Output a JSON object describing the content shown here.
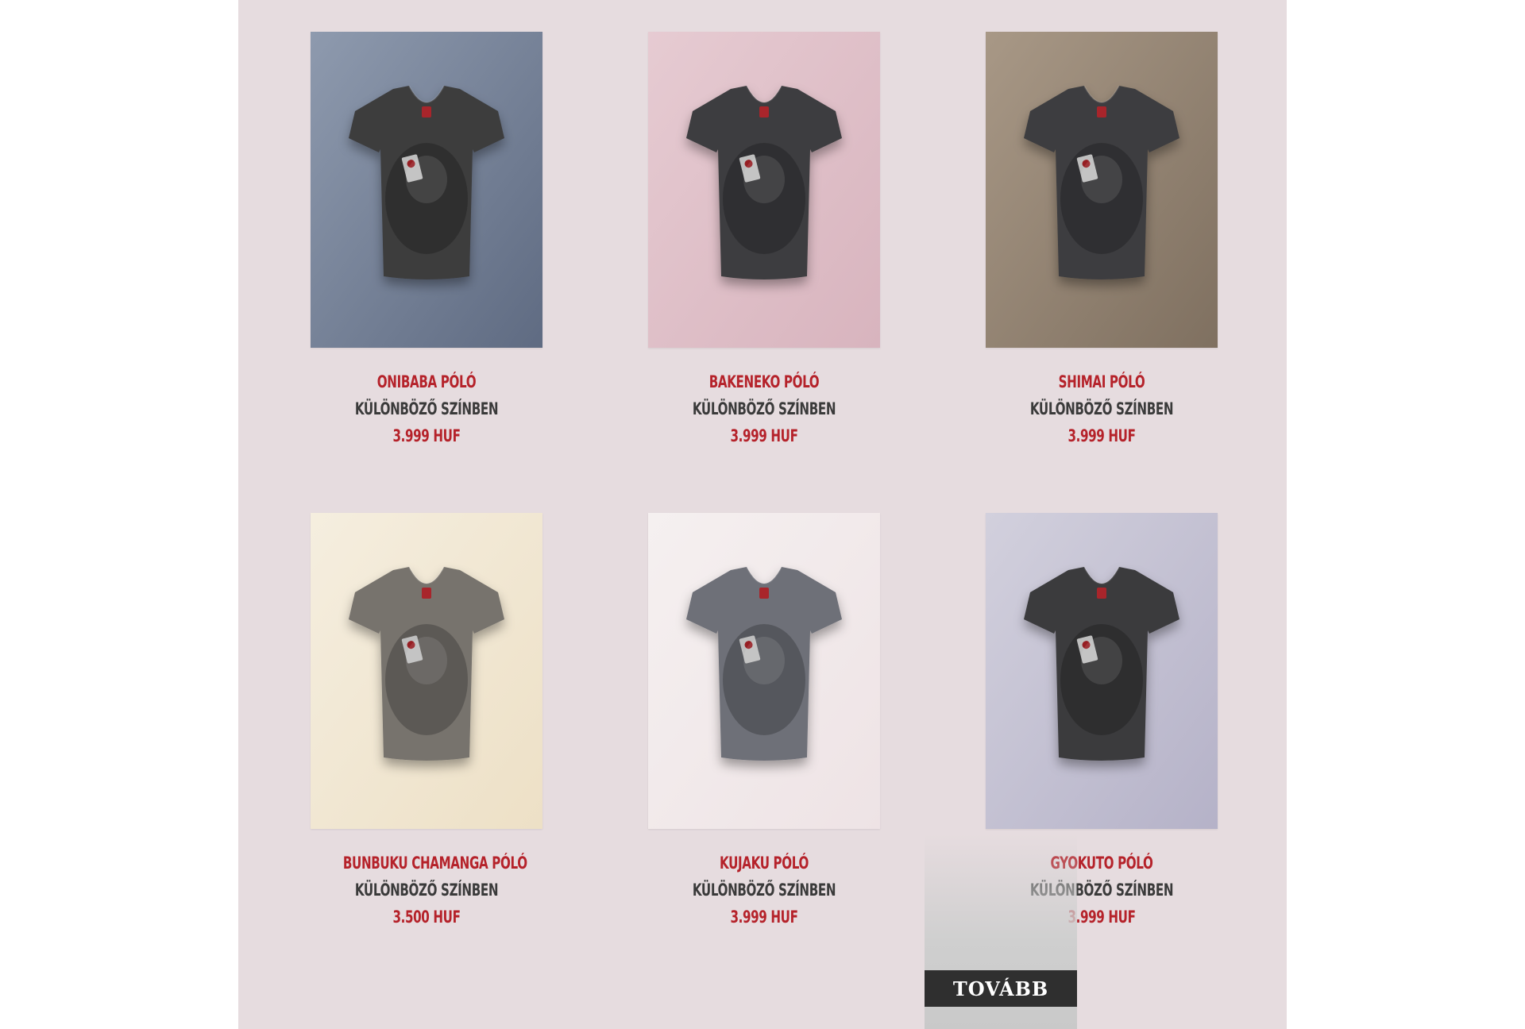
{
  "colors": {
    "page_background": "#e6dcdf",
    "name_color": "#b5222a",
    "subtitle_color": "#3a3a3a",
    "price_color": "#b5222a",
    "button_background": "#2f2f2f",
    "button_text": "#ffffff"
  },
  "products": [
    {
      "name": "Onibaba póló",
      "subtitle": "Különböző színben",
      "price": "3.999 HUF",
      "image": "dark grey v-neck t-shirt with onibaba print on slate blue background",
      "bg_top": "#8e9aae",
      "bg_bottom": "#5f6b82",
      "shirt": "#3c3c3e"
    },
    {
      "name": "Bakeneko póló",
      "subtitle": "Különböző színben",
      "price": "3.999 HUF",
      "image": "dark grey v-neck t-shirt with bakeneko cat-woman print on pink background",
      "bg_top": "#e6cbd2",
      "bg_bottom": "#d8b4be",
      "shirt": "#3e3e40"
    },
    {
      "name": "Shimai póló",
      "subtitle": "Különböző színben",
      "price": "3.999 HUF",
      "image": "dark grey v-neck t-shirt with birds print on taupe background",
      "bg_top": "#a89886",
      "bg_bottom": "#7f7060",
      "shirt": "#3d3d3f"
    },
    {
      "name": "Bunbuku chamanga póló",
      "subtitle": "Különböző színben",
      "price": "3.500 HUF",
      "image": "light grey v-neck t-shirt with tanuki print on cream background",
      "bg_top": "#f5eedf",
      "bg_bottom": "#ede0c6",
      "shirt": "#77736d"
    },
    {
      "name": "Kujaku póló",
      "subtitle": "Különböző színben",
      "price": "3.999 HUF",
      "image": "heather grey v-neck t-shirt with peacock woman print on pale pink background",
      "bg_top": "#f5f0f0",
      "bg_bottom": "#eee3e5",
      "shirt": "#6e6f78"
    },
    {
      "name": "Gyokuto póló",
      "subtitle": "Különböző színben",
      "price": "3.999 HUF",
      "image": "dark grey v-neck t-shirt with gyokuto rabbit print on lavender background",
      "bg_top": "#d2d0dd",
      "bg_bottom": "#b5b2c8",
      "shirt": "#3b3b3e"
    }
  ],
  "more_button": {
    "label": "Tovább"
  }
}
